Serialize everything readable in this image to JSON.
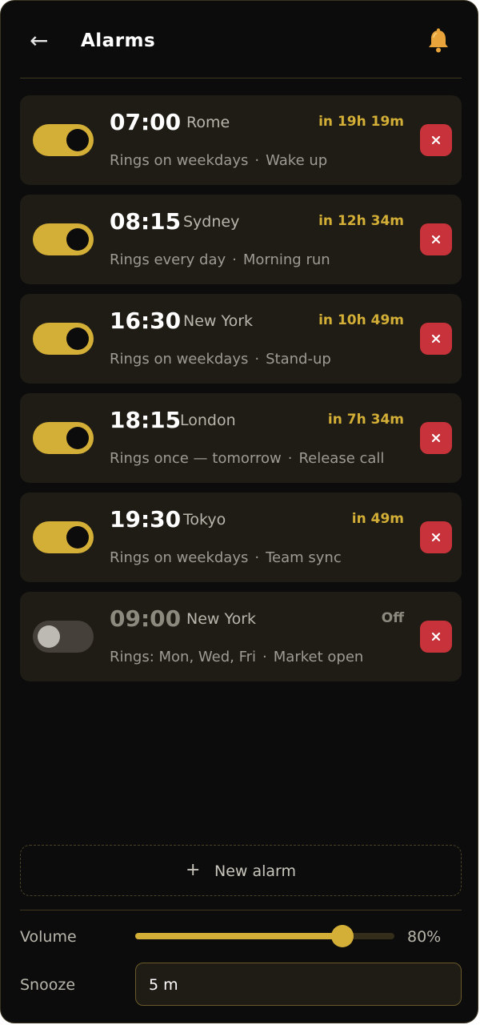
{
  "header": {
    "back_icon": "arrow-left-icon",
    "title": "Alarms",
    "bell_icon": "bell-icon"
  },
  "colors": {
    "accent": "#d4af37",
    "danger": "#c8323a",
    "card": "#1e1c14",
    "background": "#0c0c0c"
  },
  "alarms": [
    {
      "time": "07:00",
      "city": "Rome",
      "countdown": "in 19h 19m",
      "repeat": "Rings on weekdays",
      "label": "Wake up",
      "enabled": true
    },
    {
      "time": "08:15",
      "city": "Sydney",
      "countdown": "in 12h 34m",
      "repeat": "Rings every day",
      "label": "Morning run",
      "enabled": true
    },
    {
      "time": "16:30",
      "city": "New York",
      "countdown": "in 10h 49m",
      "repeat": "Rings on weekdays",
      "label": "Stand-up",
      "enabled": true
    },
    {
      "time": "18:15",
      "city": "London",
      "countdown": "in 7h 34m",
      "repeat": "Rings once — tomorrow",
      "label": "Release call",
      "enabled": true
    },
    {
      "time": "19:30",
      "city": "Tokyo",
      "countdown": "in 49m",
      "repeat": "Rings on weekdays",
      "label": "Team sync",
      "enabled": true
    },
    {
      "time": "09:00",
      "city": "New York",
      "countdown": "Off",
      "repeat": "Rings: Mon, Wed, Fri",
      "label": "Market open",
      "enabled": false
    }
  ],
  "separator": "·",
  "new_alarm": {
    "icon": "plus-icon",
    "label": "New alarm"
  },
  "settings": {
    "volume_label": "Volume",
    "volume_value": "80%",
    "volume_level": 0.8,
    "snooze_label": "Snooze",
    "snooze_value": "5 m"
  }
}
